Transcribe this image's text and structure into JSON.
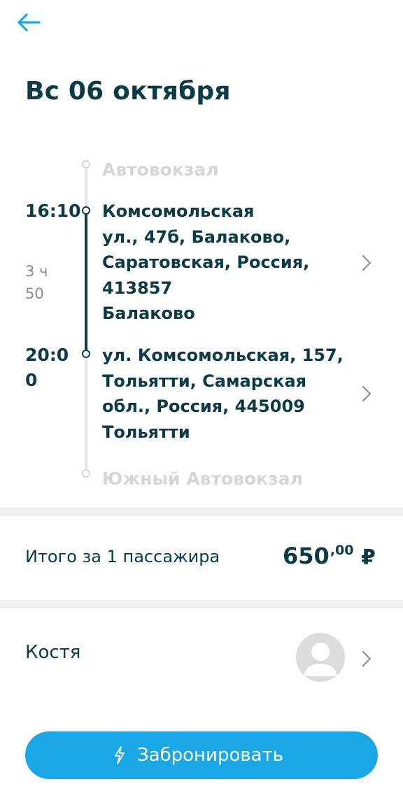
{
  "header": {
    "back_icon": "arrow-left-icon",
    "title": "Вс 06 октября"
  },
  "colors": {
    "accent": "#1aa7e6",
    "primary_text": "#0b3b45",
    "faint_text": "#d6d6d6",
    "divider": "#efefef"
  },
  "route": {
    "origin_terminal": "Автовокзал",
    "duration_line1": "3 ч",
    "duration_line2": "50",
    "departure": {
      "time_line1": "16:10",
      "lines": [
        "Комсомольская",
        "ул., 47б, Балаково,",
        "Саратовская, Россия,",
        "413857",
        "Балаково"
      ]
    },
    "arrival": {
      "time_line1": "20:0",
      "time_line2": "0",
      "lines": [
        "ул. Комсомольская, 157,",
        "Тольятти, Самарская",
        "обл., Россия, 445009",
        "Тольятти"
      ]
    },
    "destination_terminal": "Южный Автовокзал"
  },
  "total": {
    "label": "Итого за 1 пассажира",
    "price_integer": "650",
    "price_decimal": ",00",
    "currency": "₽"
  },
  "passenger": {
    "name": "Костя",
    "avatar_icon": "user-avatar-icon"
  },
  "book_button": {
    "icon": "lightning-icon",
    "label": "Забронировать"
  }
}
